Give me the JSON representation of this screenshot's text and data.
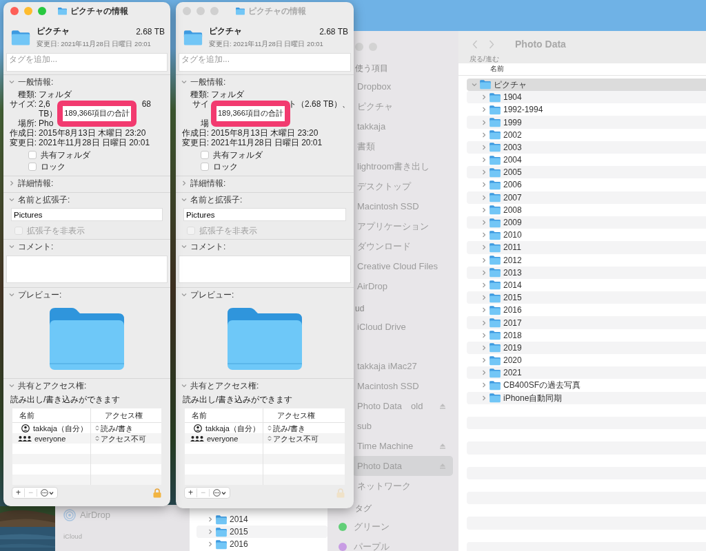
{
  "info_windows": [
    {
      "active": true,
      "title": "ピクチャの情報",
      "name": "ピクチャ",
      "size": "2.68 TB",
      "modified": "変更日: 2021年11月28日 日曜日 20:01",
      "tags": {
        "placeholder": "タグを追加..."
      },
      "general": {
        "header": "一般情報:",
        "expanded": true,
        "rows": [
          {
            "kind": "row",
            "label": "種類:",
            "parts": [
              {
                "text": "フォルダ",
                "after_cover": false
              }
            ]
          },
          {
            "kind": "row",
            "label": "サイズ:",
            "parts": [
              {
                "text": "2,6",
                "after_cover": false
              },
              {
                "text": "68",
                "after_cover": true
              }
            ]
          },
          {
            "kind": "highlight",
            "lead": "TB）",
            "text": "189,366項目の合計"
          },
          {
            "kind": "row",
            "label": "場所:",
            "parts": [
              {
                "text": "Pho",
                "after_cover": false
              }
            ]
          },
          {
            "kind": "row",
            "label": "作成日:",
            "parts": [
              {
                "text": "2015年8月13日 木曜日 23:20",
                "after_cover": false
              }
            ]
          },
          {
            "kind": "row",
            "label": "変更日:",
            "parts": [
              {
                "text": "2021年11月28日 日曜日 20:01",
                "after_cover": false
              }
            ]
          }
        ],
        "checkboxes": [
          {
            "label": "共有フォルダ",
            "checked": false
          },
          {
            "label": "ロック",
            "checked": false
          }
        ]
      },
      "more_info": {
        "header": "詳細情報:",
        "expanded": false
      },
      "name_ext": {
        "header": "名前と拡張子:",
        "expanded": true,
        "value": "Pictures",
        "hide_extension": {
          "label": "拡張子を非表示",
          "checked": false,
          "disabled": true
        }
      },
      "comments": {
        "header": "コメント:",
        "expanded": true
      },
      "preview": {
        "header": "プレビュー:",
        "expanded": true
      },
      "sharing": {
        "header": "共有とアクセス権:",
        "expanded": true,
        "summary": "読み出し/書き込みができます",
        "columns": [
          "名前",
          "アクセス権"
        ],
        "rows": [
          {
            "kind": "user",
            "name": "takkaja（自分）",
            "privilege": "読み/書き"
          },
          {
            "kind": "group",
            "name": "everyone",
            "privilege": "アクセス不可"
          }
        ],
        "buttons": [
          "+",
          "−"
        ]
      }
    },
    {
      "active": false,
      "title": "ピクチャの情報",
      "name": "ピクチャ",
      "size": "2.68 TB",
      "modified": "変更日: 2021年11月28日 日曜日 20:01",
      "tags": {
        "placeholder": "タグを追加..."
      },
      "general": {
        "header": "一般情報:",
        "expanded": true,
        "rows": [
          {
            "kind": "row",
            "label": "種類:",
            "parts": [
              {
                "text": "フォルダ",
                "after_cover": false
              }
            ]
          },
          {
            "kind": "row",
            "label": "サイ",
            "parts": [
              {
                "text": "ト（2.68 TB）、",
                "after_cover": true
              }
            ]
          },
          {
            "kind": "highlight",
            "text": "189,366項目の合計"
          },
          {
            "kind": "row",
            "label": "場"
          },
          {
            "kind": "row",
            "label": "作成日:",
            "parts": [
              {
                "text": "2015年8月13日 木曜日 23:20",
                "after_cover": false
              }
            ]
          },
          {
            "kind": "row",
            "label": "変更日:",
            "parts": [
              {
                "text": "2021年11月28日 日曜日 20:01",
                "after_cover": false
              }
            ]
          }
        ],
        "checkboxes": [
          {
            "label": "共有フォルダ",
            "checked": false
          },
          {
            "label": "ロック",
            "checked": false
          }
        ]
      },
      "more_info": {
        "header": "詳細情報:",
        "expanded": false
      },
      "name_ext": {
        "header": "名前と拡張子:",
        "expanded": true,
        "value": "Pictures",
        "hide_extension": {
          "label": "拡張子を非表示",
          "checked": false,
          "disabled": true
        }
      },
      "comments": {
        "header": "コメント:",
        "expanded": true
      },
      "preview": {
        "header": "プレビュー:",
        "expanded": true
      },
      "sharing": {
        "header": "共有とアクセス権:",
        "expanded": true,
        "summary": "読み出し/書き込みができます",
        "columns": [
          "名前",
          "アクセス権"
        ],
        "rows": [
          {
            "kind": "user",
            "name": "takkaja（自分）",
            "privilege": "読み/書き"
          },
          {
            "kind": "group",
            "name": "everyone",
            "privilege": "アクセス不可"
          }
        ],
        "buttons": [
          "+",
          "−"
        ]
      }
    }
  ],
  "finder": {
    "title": "Photo Data",
    "nav_label": "戻る/進む",
    "column": "名前",
    "sidebar": [
      {
        "header": "使う項目",
        "items": [
          {
            "label": "Dropbox",
            "selected": false,
            "ejectable": false
          },
          {
            "label": "ピクチャ",
            "selected": false,
            "ejectable": false
          },
          {
            "label": "takkaja",
            "selected": false,
            "ejectable": false
          },
          {
            "label": "書類",
            "selected": false,
            "ejectable": false
          },
          {
            "label": "lightroom書き出し",
            "selected": false,
            "ejectable": false
          },
          {
            "label": "デスクトップ",
            "selected": false,
            "ejectable": false
          },
          {
            "label": "Macintosh SSD",
            "selected": false,
            "ejectable": false
          },
          {
            "label": "アプリケーション",
            "selected": false,
            "ejectable": false
          },
          {
            "label": "ダウンロード",
            "selected": false,
            "ejectable": false
          },
          {
            "label": "Creative Cloud Files",
            "selected": false,
            "ejectable": false
          },
          {
            "label": "AirDrop",
            "selected": false,
            "ejectable": false
          }
        ]
      },
      {
        "header": "ud",
        "items": [
          {
            "label": "iCloud Drive",
            "selected": false,
            "ejectable": false
          }
        ]
      },
      {
        "items": [
          {
            "label": "takkaja iMac27",
            "selected": false,
            "ejectable": false
          },
          {
            "label": "Macintosh SSD",
            "selected": false,
            "ejectable": false
          },
          {
            "label": "Photo Data　old",
            "selected": false,
            "ejectable": true
          },
          {
            "label": "sub",
            "selected": false,
            "ejectable": false
          },
          {
            "label": "Time Machine",
            "selected": false,
            "ejectable": true
          },
          {
            "label": "Photo Data",
            "selected": true,
            "ejectable": true
          },
          {
            "label": "ネットワーク",
            "selected": false,
            "ejectable": false
          }
        ]
      },
      {
        "header": "タグ",
        "items": [
          {
            "label": "グリーン",
            "selected": false,
            "color": "#62cf78"
          },
          {
            "label": "パープル",
            "selected": false,
            "color": "#c89ce4"
          }
        ]
      }
    ],
    "tree": [
      {
        "name": "ピクチャ",
        "expanded": true,
        "selected": true,
        "children": [
          {
            "name": "1904",
            "expanded": false,
            "selected": false
          },
          {
            "name": "1992-1994",
            "expanded": false,
            "selected": false
          },
          {
            "name": "1999",
            "expanded": false,
            "selected": false
          },
          {
            "name": "2002",
            "expanded": false,
            "selected": false
          },
          {
            "name": "2003",
            "expanded": false,
            "selected": false
          },
          {
            "name": "2004",
            "expanded": false,
            "selected": false
          },
          {
            "name": "2005",
            "expanded": false,
            "selected": false
          },
          {
            "name": "2006",
            "expanded": false,
            "selected": false
          },
          {
            "name": "2007",
            "expanded": false,
            "selected": false
          },
          {
            "name": "2008",
            "expanded": false,
            "selected": false
          },
          {
            "name": "2009",
            "expanded": false,
            "selected": false
          },
          {
            "name": "2010",
            "expanded": false,
            "selected": false
          },
          {
            "name": "2011",
            "expanded": false,
            "selected": false
          },
          {
            "name": "2012",
            "expanded": false,
            "selected": false
          },
          {
            "name": "2013",
            "expanded": false,
            "selected": false
          },
          {
            "name": "2014",
            "expanded": false,
            "selected": false
          },
          {
            "name": "2015",
            "expanded": false,
            "selected": false
          },
          {
            "name": "2016",
            "expanded": false,
            "selected": false
          },
          {
            "name": "2017",
            "expanded": false,
            "selected": false
          },
          {
            "name": "2018",
            "expanded": false,
            "selected": false
          },
          {
            "name": "2019",
            "expanded": false,
            "selected": false
          },
          {
            "name": "2020",
            "expanded": false,
            "selected": false
          },
          {
            "name": "2021",
            "expanded": false,
            "selected": false
          },
          {
            "name": "CB400SFの過去写真",
            "expanded": false,
            "selected": false
          },
          {
            "name": "iPhone自動同期",
            "expanded": false,
            "selected": false
          }
        ]
      }
    ]
  },
  "back_window": {
    "sidebar": [
      {
        "kind": "item",
        "label": "AirDrop"
      },
      {
        "kind": "header",
        "label": "iCloud"
      }
    ],
    "rows": [
      {
        "name": "2014",
        "expanded": false,
        "selected": false
      },
      {
        "name": "2015",
        "expanded": false,
        "selected": false
      },
      {
        "name": "2016",
        "expanded": false,
        "selected": false
      }
    ]
  }
}
